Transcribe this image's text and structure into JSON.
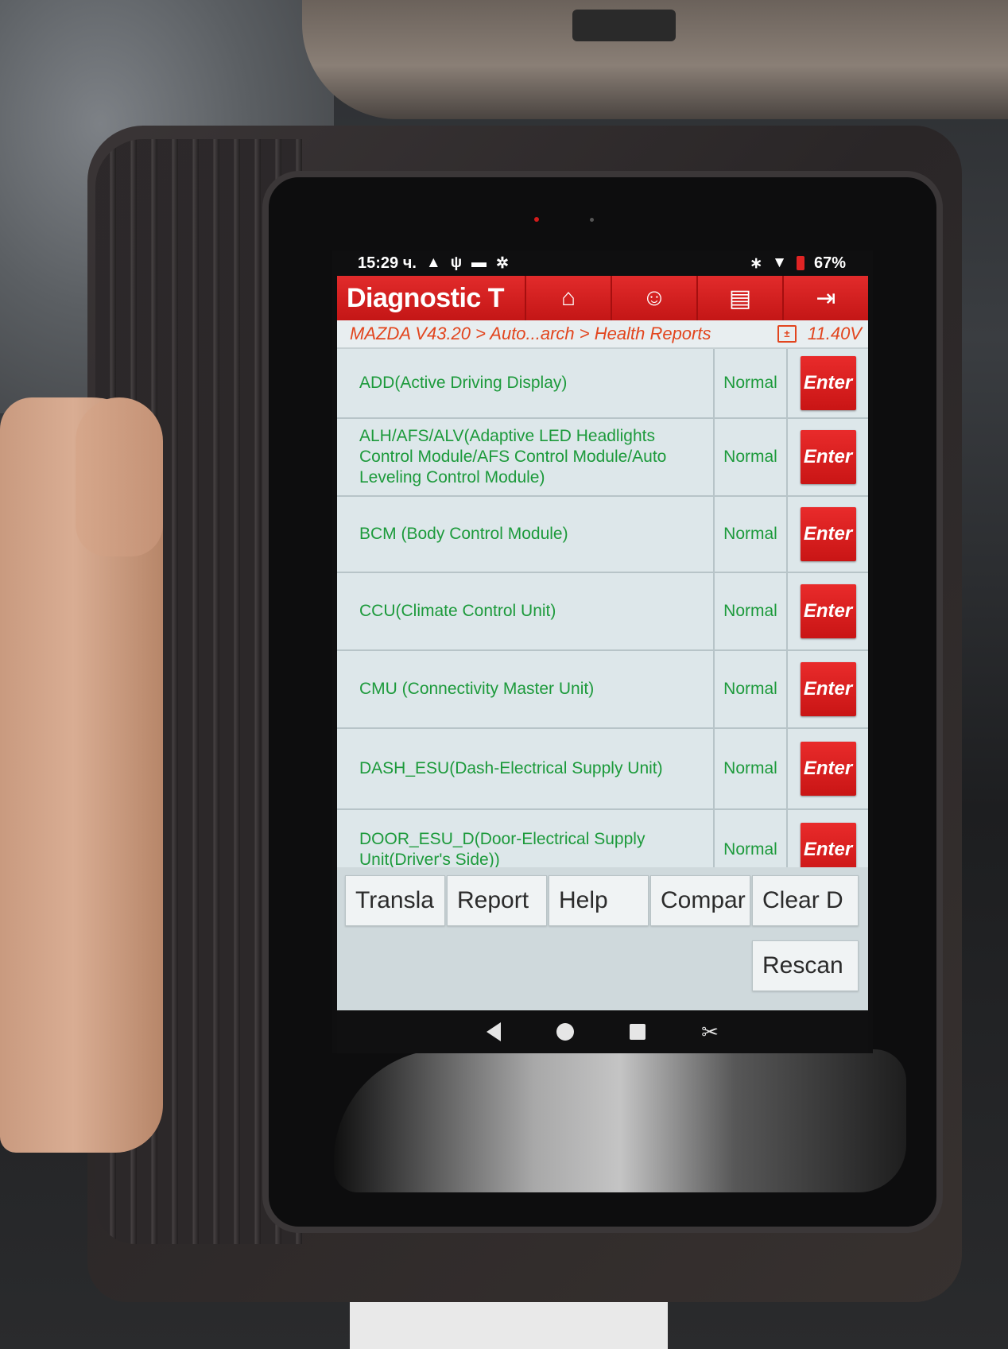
{
  "status_bar": {
    "time": "15:29 ч.",
    "left_icons": [
      "warning-icon",
      "usb-icon",
      "message-icon",
      "settings-icon"
    ],
    "right_icons": [
      "bluetooth-icon",
      "wifi-icon",
      "battery-icon"
    ],
    "battery": "67%"
  },
  "app": {
    "title": "Diagnostic T",
    "toolbar": {
      "icons": [
        "home-icon",
        "user-icon",
        "print-icon",
        "exit-icon"
      ]
    },
    "breadcrumb": "MAZDA V43.20 > Auto...arch > Health Reports",
    "voltage": "11.40V"
  },
  "modules": [
    {
      "name": "ADD(Active Driving Display)",
      "status": "Normal",
      "action": "Enter"
    },
    {
      "name": "ALH/AFS/ALV(Adaptive LED Headlights Control Module/AFS Control Module/Auto Leveling Control Module)",
      "status": "Normal",
      "action": "Enter"
    },
    {
      "name": "BCM (Body Control Module)",
      "status": "Normal",
      "action": "Enter"
    },
    {
      "name": "CCU(Climate Control Unit)",
      "status": "Normal",
      "action": "Enter"
    },
    {
      "name": "CMU (Connectivity Master Unit)",
      "status": "Normal",
      "action": "Enter"
    },
    {
      "name": "DASH_ESU(Dash-Electrical Supply Unit)",
      "status": "Normal",
      "action": "Enter"
    },
    {
      "name": "DOOR_ESU_D(Door-Electrical Supply Unit(Driver's Side))",
      "status": "Normal",
      "action": "Enter"
    }
  ],
  "footer_buttons": {
    "translate": "Transla",
    "report": "Report",
    "help": "Help",
    "compare": "Compar",
    "clear": "Clear D",
    "rescan": "Rescan"
  },
  "nav_icons": [
    "back-icon",
    "home-circle-icon",
    "recents-icon",
    "screenshot-icon"
  ],
  "colors": {
    "header_red": "#d41f1f",
    "module_text": "#1c9a3b",
    "breadcrumb_orange": "#e2451e",
    "list_bg": "#dde7ea"
  }
}
